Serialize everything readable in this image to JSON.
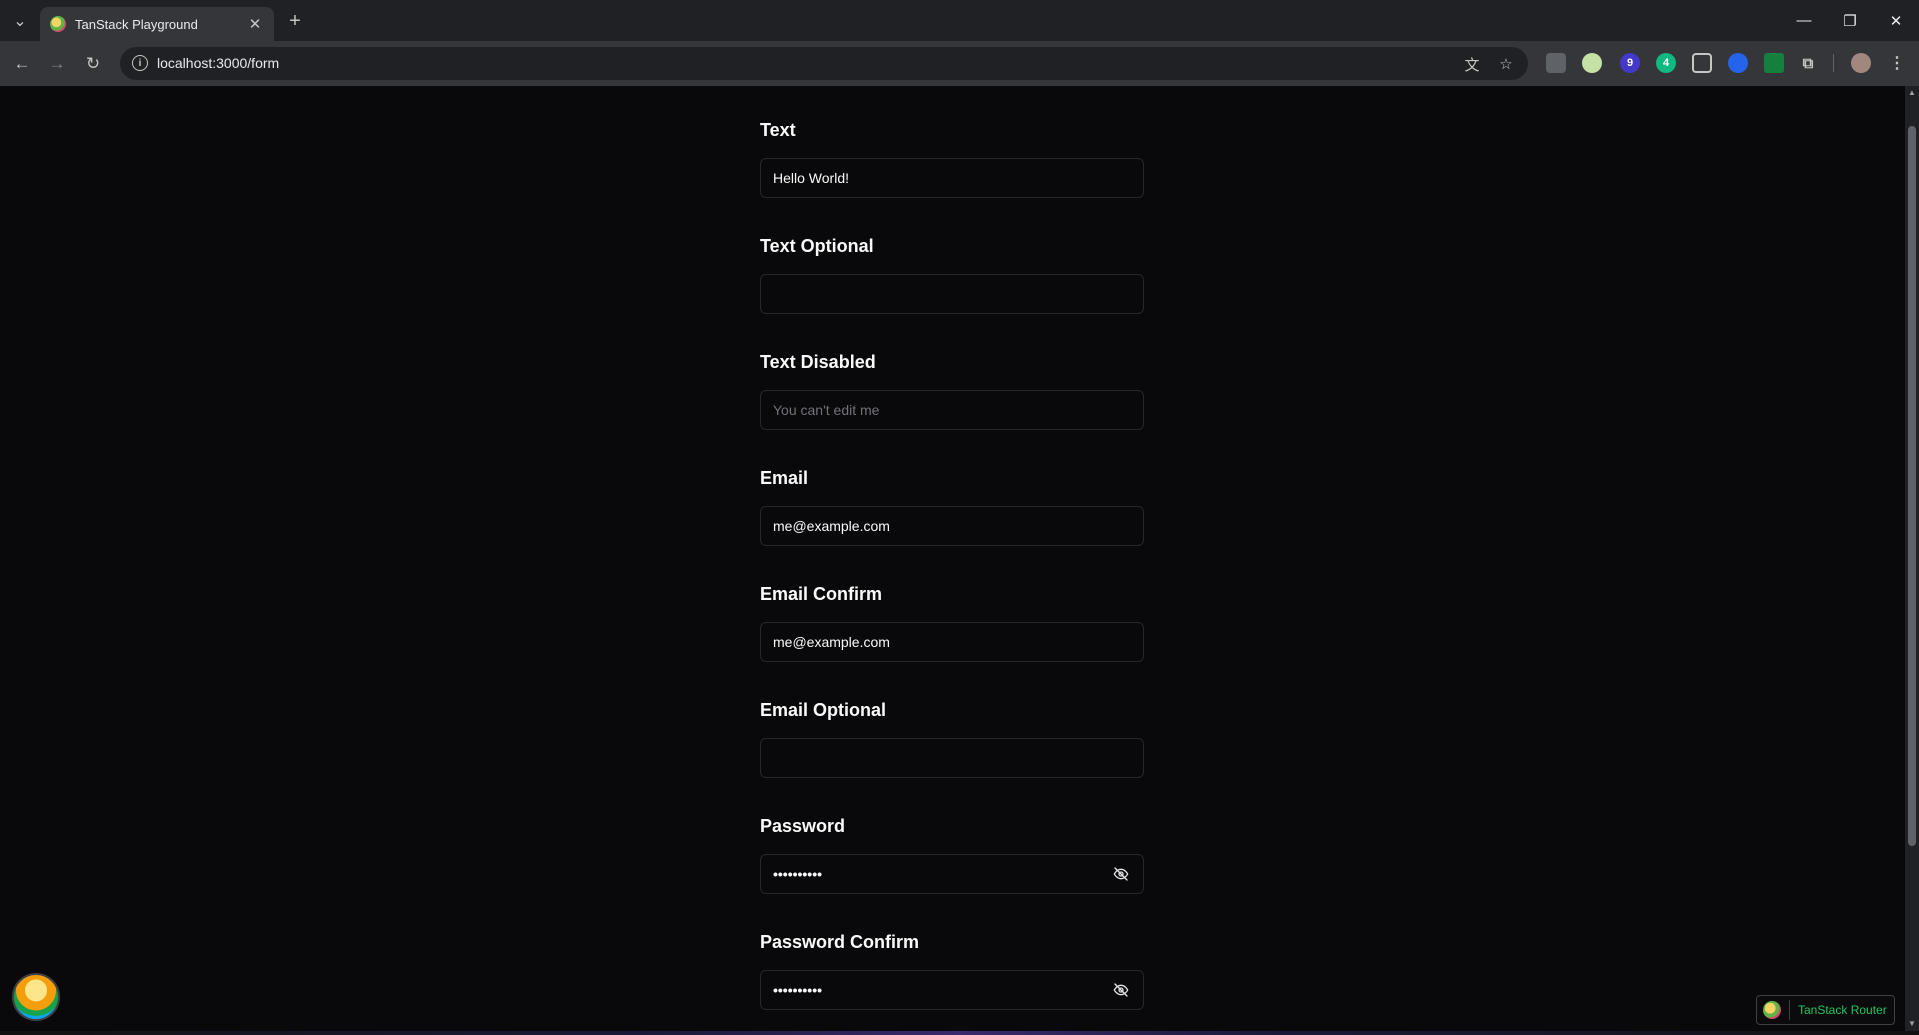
{
  "browser": {
    "tab_title": "TanStack Playground",
    "url": "localhost:3000/form",
    "close_glyph": "✕",
    "newtab_glyph": "+",
    "tab_list_glyph": "⌄",
    "minimize_glyph": "—",
    "restore_glyph": "❐",
    "window_close_glyph": "✕",
    "back_glyph": "←",
    "forward_glyph": "→",
    "reload_glyph": "↻",
    "info_glyph": "i",
    "translate_glyph": "文",
    "bookmark_glyph": "☆",
    "extensions_glyph": "⧉",
    "menu_glyph": "⋮",
    "ext_badge_1": "9",
    "ext_badge_2": "4"
  },
  "form": {
    "fields": [
      {
        "label": "Text",
        "value": "Hello World!",
        "type": "text"
      },
      {
        "label": "Text Optional",
        "value": "",
        "type": "text"
      },
      {
        "label": "Text Disabled",
        "value": "You can't edit me",
        "type": "disabled"
      },
      {
        "label": "Email",
        "value": "me@example.com",
        "type": "email"
      },
      {
        "label": "Email Confirm",
        "value": "me@example.com",
        "type": "email"
      },
      {
        "label": "Email Optional",
        "value": "",
        "type": "email"
      },
      {
        "label": "Password",
        "value": "••••••••••",
        "type": "password"
      },
      {
        "label": "Password Confirm",
        "value": "••••••••••",
        "type": "password"
      }
    ]
  },
  "router_badge": {
    "label": "TanStack Router"
  },
  "colors": {
    "background": "#09090b",
    "border": "#27272a",
    "accent": "#22c55e"
  }
}
